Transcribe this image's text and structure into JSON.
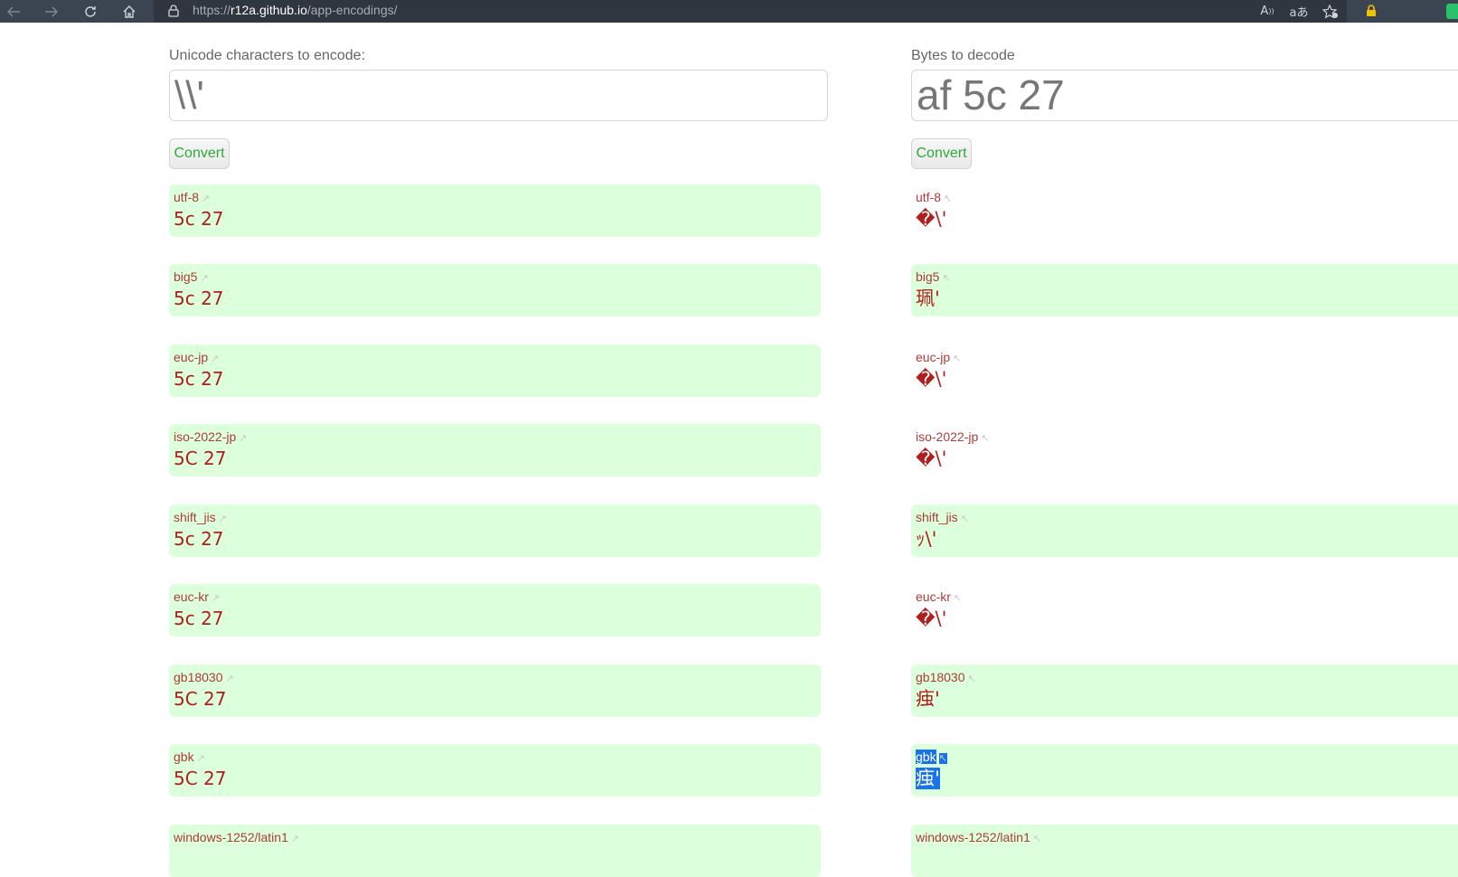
{
  "browser": {
    "url_scheme": "https://",
    "url_host": "r12a.github.io",
    "url_path": "/app-encodings/",
    "icons": [
      "back-icon",
      "forward-icon",
      "reload-icon",
      "home-icon",
      "lock-icon",
      "read-aloud-icon",
      "translate-icon",
      "favorites-icon",
      "shield-lock-icon",
      "extension-icon"
    ]
  },
  "encode_panel": {
    "label": "Unicode characters to encode:",
    "input_value": "\\\\'",
    "convert_label": "Convert",
    "results": [
      {
        "name": "utf-8",
        "value": "5c 27"
      },
      {
        "name": "big5",
        "value": "5c 27"
      },
      {
        "name": "euc-jp",
        "value": "5c 27"
      },
      {
        "name": "iso-2022-jp",
        "value": "5C 27"
      },
      {
        "name": "shift_jis",
        "value": "5c 27"
      },
      {
        "name": "euc-kr",
        "value": "5c 27"
      },
      {
        "name": "gb18030",
        "value": "5C 27"
      },
      {
        "name": "gbk",
        "value": "5C 27"
      },
      {
        "name": "windows-1252/latin1",
        "value": ""
      }
    ]
  },
  "decode_panel": {
    "label": "Bytes to decode",
    "input_value": "af 5c 27",
    "convert_label": "Convert",
    "results": [
      {
        "name": "utf-8",
        "value": "�\\'"
      },
      {
        "name": "big5",
        "value": "珮'"
      },
      {
        "name": "euc-jp",
        "value": "�\\'"
      },
      {
        "name": "iso-2022-jp",
        "value": "�\\'"
      },
      {
        "name": "shift_jis",
        "value": "ｯ\\'"
      },
      {
        "name": "euc-kr",
        "value": "�\\'"
      },
      {
        "name": "gb18030",
        "value": "痋'"
      },
      {
        "name": "gbk",
        "value": "痋'"
      },
      {
        "name": "windows-1252/latin1",
        "value": ""
      }
    ]
  },
  "arrow_glyphs": {
    "encode": "↗",
    "decode": "↖"
  },
  "colors": {
    "accent_green": "#2eaa3a",
    "result_bg": "#dcffdc",
    "result_text": "#b01e1e",
    "selection": "#1a73e8"
  }
}
